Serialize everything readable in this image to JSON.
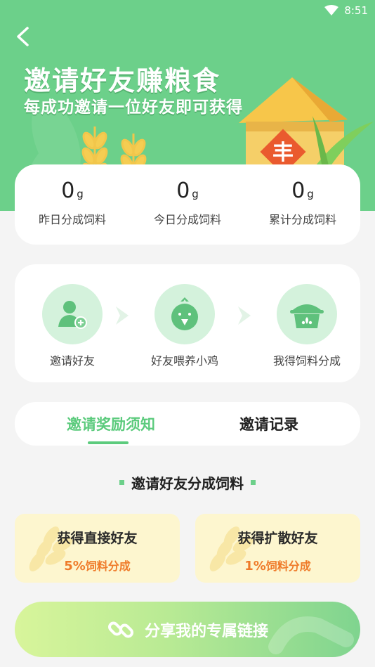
{
  "status_bar": {
    "time": "8:51",
    "wifi_icon": "wifi-icon"
  },
  "header": {
    "back_icon": "back-arrow-icon",
    "title": "邀请好友赚粮食",
    "subtitle": "每成功邀请一位好友即可获得",
    "barn_sign": "丰"
  },
  "stats": [
    {
      "value": "0",
      "unit": "g",
      "label": "昨日分成饲料"
    },
    {
      "value": "0",
      "unit": "g",
      "label": "今日分成饲料"
    },
    {
      "value": "0",
      "unit": "g",
      "label": "累计分成饲料"
    }
  ],
  "steps": [
    {
      "icon": "add-user-icon",
      "label": "邀请好友"
    },
    {
      "icon": "chick-icon",
      "label": "好友喂养小鸡"
    },
    {
      "icon": "feed-pot-icon",
      "label": "我得饲料分成"
    }
  ],
  "tabs": {
    "active": "邀请奖励须知",
    "inactive": "邀请记录"
  },
  "section": {
    "title": "邀请好友分成饲料"
  },
  "rewards": [
    {
      "title": "获得直接好友",
      "percent": "5%",
      "suffix": "饲料分成"
    },
    {
      "title": "获得扩散好友",
      "percent": "1%",
      "suffix": "饲料分成"
    }
  ],
  "share_button": {
    "label": "分享我的专属链接",
    "icon": "link-icon"
  },
  "colors": {
    "primary_green": "#6cd08a",
    "tab_active": "#5ccb7d",
    "reward_orange": "#ef7b2a",
    "reward_bg": "#fdf6cf"
  }
}
